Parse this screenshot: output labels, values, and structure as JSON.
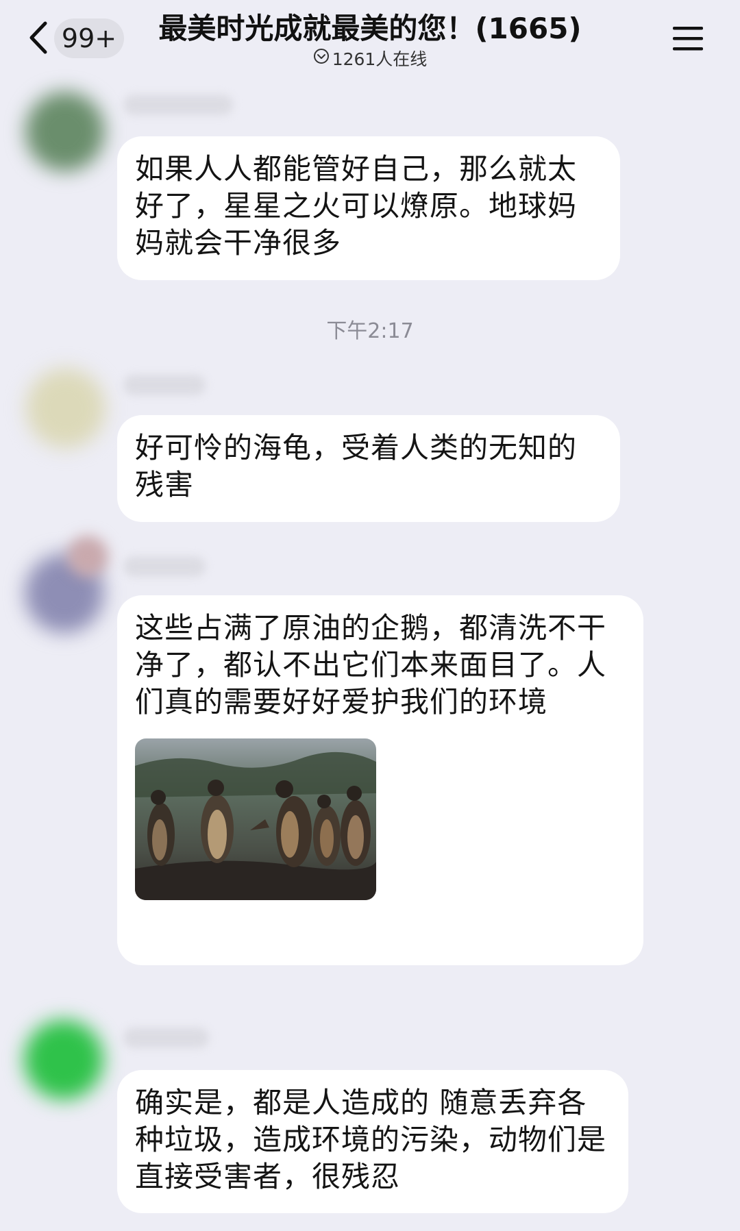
{
  "header": {
    "unread_count": "99+",
    "title": "最美时光成就最美的您！(1665)",
    "online_status": "1261人在线"
  },
  "messages": [
    {
      "text": "如果人人都能管好自己，那么就太好了，星星之火可以燎原。地球妈妈就会干净很多"
    },
    {
      "text": "好可怜的海龟，受着人类的无知的残害"
    },
    {
      "text": "这些占满了原油的企鹅，都清洗不干净了，都认不出它们本来面目了。人们真的需要好好爱护我们的环境"
    },
    {
      "text": "确实是，都是人造成的 随意丢弃各种垃圾，造成环境的污染，动物们是直接受害者，很残忍"
    }
  ],
  "timestamp": "下午2:17",
  "icons": {
    "back": "chevron-left-icon",
    "online": "chevron-down-circle-icon",
    "menu": "hamburger-menu-icon"
  },
  "colors": {
    "background": "#ededf5",
    "bubble": "#ffffff",
    "badge": "#dfdfe6",
    "timestamp": "#8b8b95"
  }
}
